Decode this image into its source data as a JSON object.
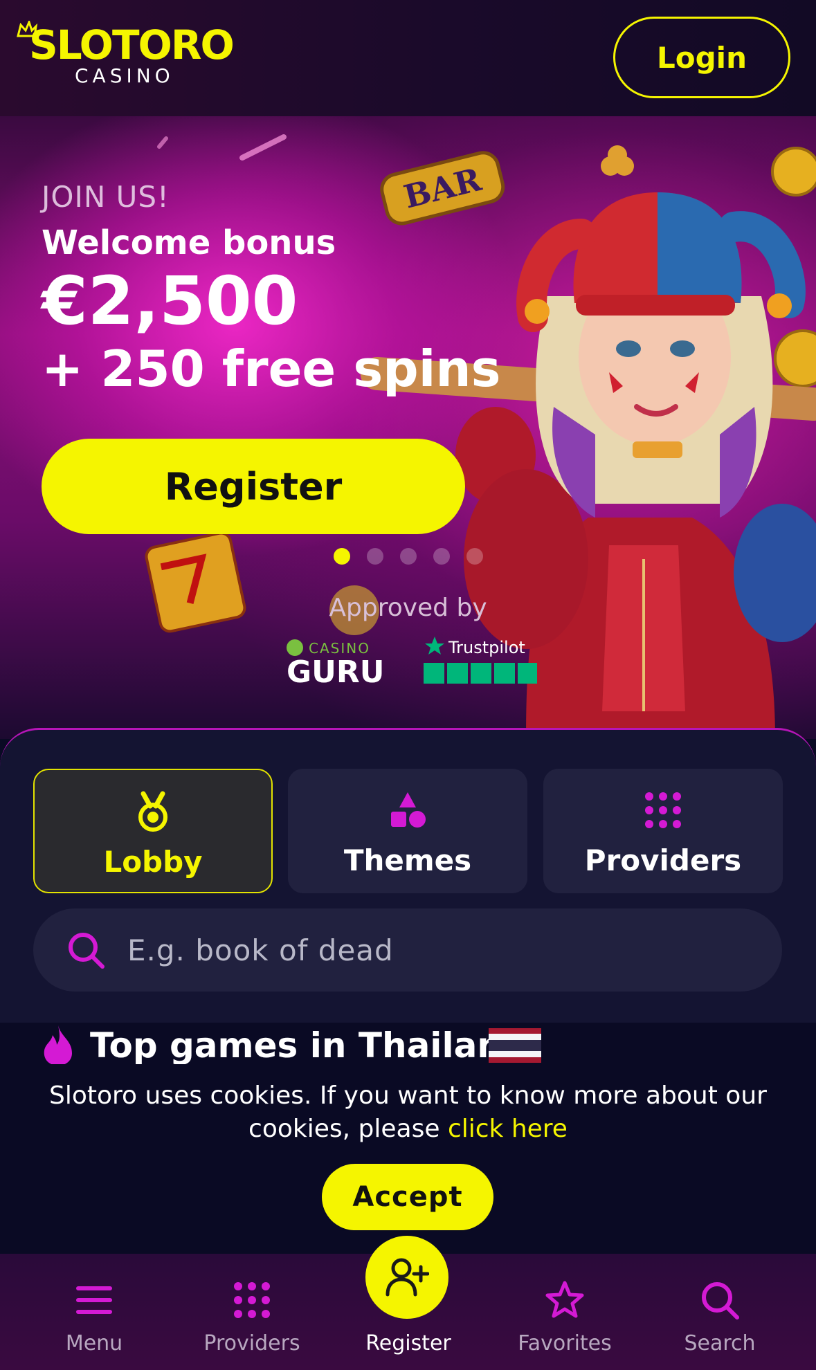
{
  "header": {
    "logo_brand": "SLOTORO",
    "logo_sub": "CASINO",
    "login_label": "Login"
  },
  "hero": {
    "join": "JOIN US!",
    "welcome": "Welcome bonus",
    "amount": "€2,500",
    "spins": "+ 250 free spins",
    "register_label": "Register",
    "slide_count": 5,
    "active_slide": 1,
    "approved_by": "Approved by",
    "badges": [
      "CASINO GURU",
      "Trustpilot"
    ]
  },
  "tabs": [
    {
      "label": "Lobby",
      "icon": "medal-icon",
      "active": true
    },
    {
      "label": "Themes",
      "icon": "shapes-icon",
      "active": false
    },
    {
      "label": "Providers",
      "icon": "grid-dots-icon",
      "active": false
    }
  ],
  "search": {
    "placeholder": "E.g. book of dead",
    "icon": "search-icon"
  },
  "top_games": {
    "title": "Top games in Thailand",
    "icon": "fire-icon",
    "flag": "thailand-flag"
  },
  "cookie": {
    "text": "Slotoro uses cookies. If you want to know more about our cookies, please",
    "link": "click here",
    "accept_label": "Accept"
  },
  "bottom_nav": [
    {
      "label": "Menu",
      "icon": "hamburger-icon"
    },
    {
      "label": "Providers",
      "icon": "grid-dots-icon"
    },
    {
      "label": "Register",
      "icon": "add-user-icon"
    },
    {
      "label": "Favorites",
      "icon": "star-icon"
    },
    {
      "label": "Search",
      "icon": "search-icon"
    }
  ],
  "colors": {
    "accent_yellow": "#f5f500",
    "accent_magenta": "#d41ad4",
    "panel_bg": "#141432",
    "page_bg": "#0a0a24"
  }
}
